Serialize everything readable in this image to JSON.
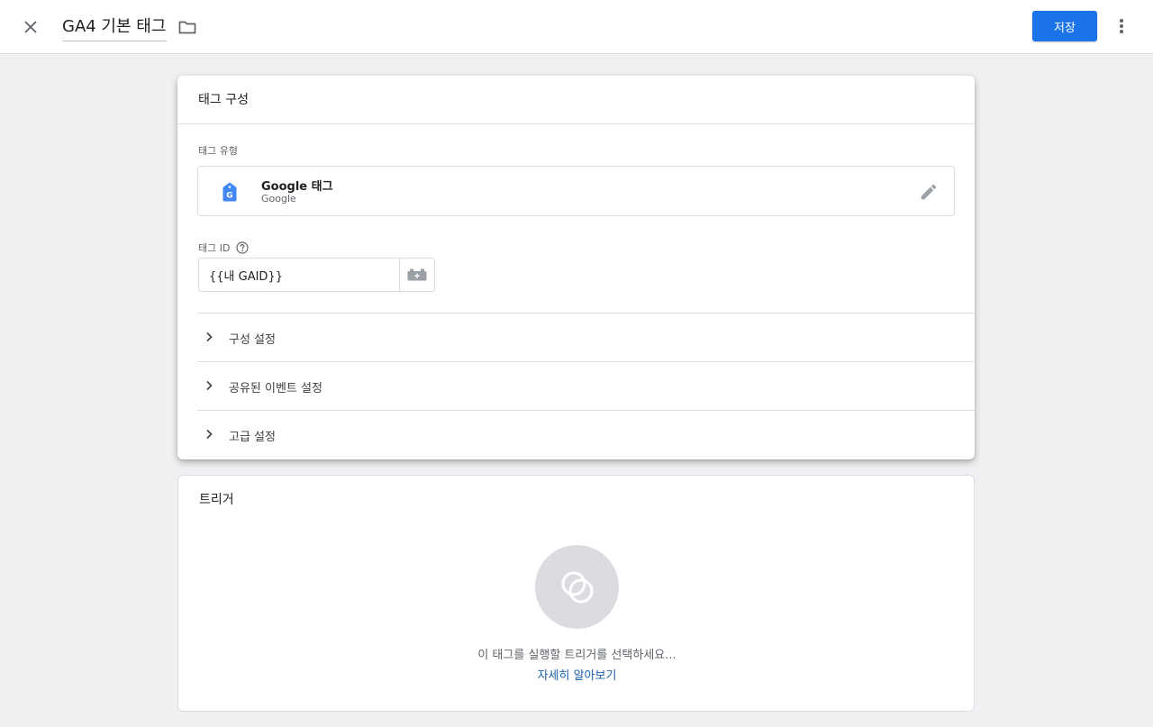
{
  "header": {
    "tag_name": "GA4 기본 태그",
    "save_label": "저장"
  },
  "config": {
    "title": "태그 구성",
    "tag_type_label": "태그 유형",
    "tag_type": {
      "name": "Google 태그",
      "vendor": "Google",
      "icon": "google-tag-icon"
    },
    "tag_id_label": "태그 ID",
    "tag_id_value": "{{내 GAID}}",
    "sections": [
      {
        "label": "구성 설정"
      },
      {
        "label": "공유된 이벤트 설정"
      },
      {
        "label": "고급 설정"
      }
    ]
  },
  "trigger": {
    "title": "트리거",
    "hint": "이 태그를 실행할 트리거를 선택하세요...",
    "learn_more": "자세히 알아보기"
  },
  "colors": {
    "primary": "#1a73e8",
    "background": "#eef0f2",
    "link": "#1a5fa8"
  }
}
